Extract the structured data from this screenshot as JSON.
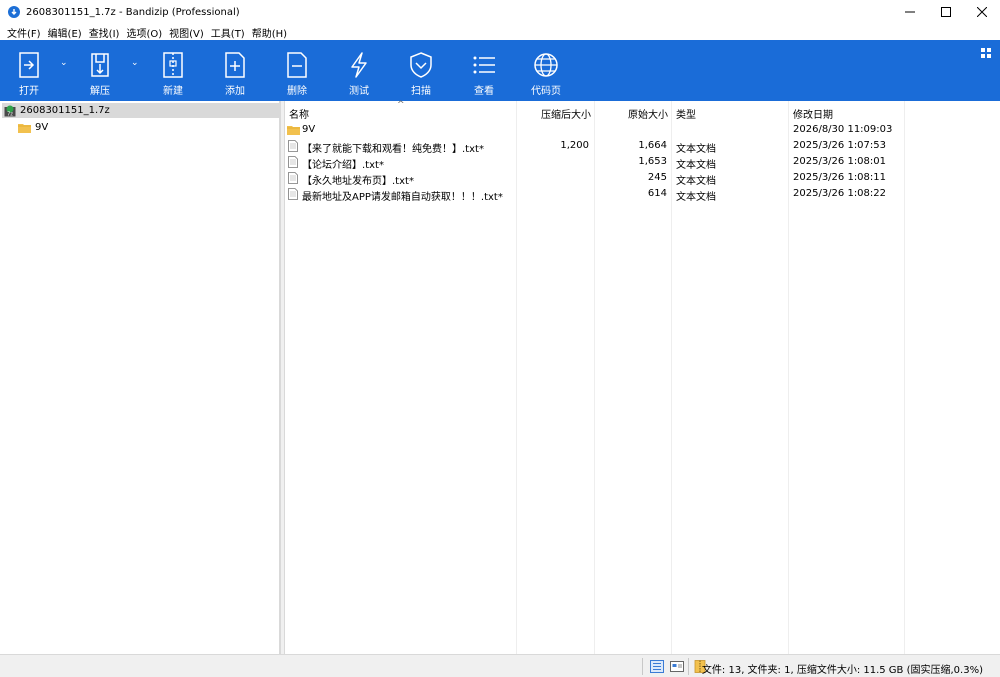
{
  "window": {
    "title": "2608301151_1.7z - Bandizip (Professional)"
  },
  "menu": [
    "文件(F)",
    "编辑(E)",
    "查找(I)",
    "选项(O)",
    "视图(V)",
    "工具(T)",
    "帮助(H)"
  ],
  "toolbar": {
    "open": "打开",
    "extract": "解压",
    "new": "新建",
    "add": "添加",
    "delete": "删除",
    "test": "测试",
    "scan": "扫描",
    "view": "查看",
    "codepage": "代码页"
  },
  "tree": {
    "root": "2608301151_1.7z",
    "children": [
      "9V"
    ]
  },
  "columns": {
    "name": "名称",
    "packed": "压缩后大小",
    "size": "原始大小",
    "type": "类型",
    "modified": "修改日期"
  },
  "files": [
    {
      "icon": "folder-icon",
      "name": "9V",
      "packed": "",
      "size": "",
      "type": "",
      "modified": "2026/8/30 11:09:03"
    },
    {
      "icon": "text-file-icon",
      "name": "【来了就能下载和观看！纯免费！】.txt*",
      "packed": "1,200",
      "size": "1,664",
      "type": "文本文档",
      "modified": "2025/3/26 1:07:53"
    },
    {
      "icon": "text-file-icon",
      "name": "【论坛介绍】.txt*",
      "packed": "",
      "size": "1,653",
      "type": "文本文档",
      "modified": "2025/3/26 1:08:01"
    },
    {
      "icon": "text-file-icon",
      "name": "【永久地址发布页】.txt*",
      "packed": "",
      "size": "245",
      "type": "文本文档",
      "modified": "2025/3/26 1:08:11"
    },
    {
      "icon": "text-file-icon",
      "name": "最新地址及APP请发邮箱自动获取！！！.txt*",
      "packed": "",
      "size": "614",
      "type": "文本文档",
      "modified": "2025/3/26 1:08:22"
    }
  ],
  "status": {
    "text": "文件: 13, 文件夹: 1, 压缩文件大小: 11.5 GB (固实压缩,0.3%)"
  },
  "colors": {
    "toolbar_bg": "#1a6cd8",
    "selection_bg": "#d9d9d9",
    "folder": "#f2c14e"
  }
}
